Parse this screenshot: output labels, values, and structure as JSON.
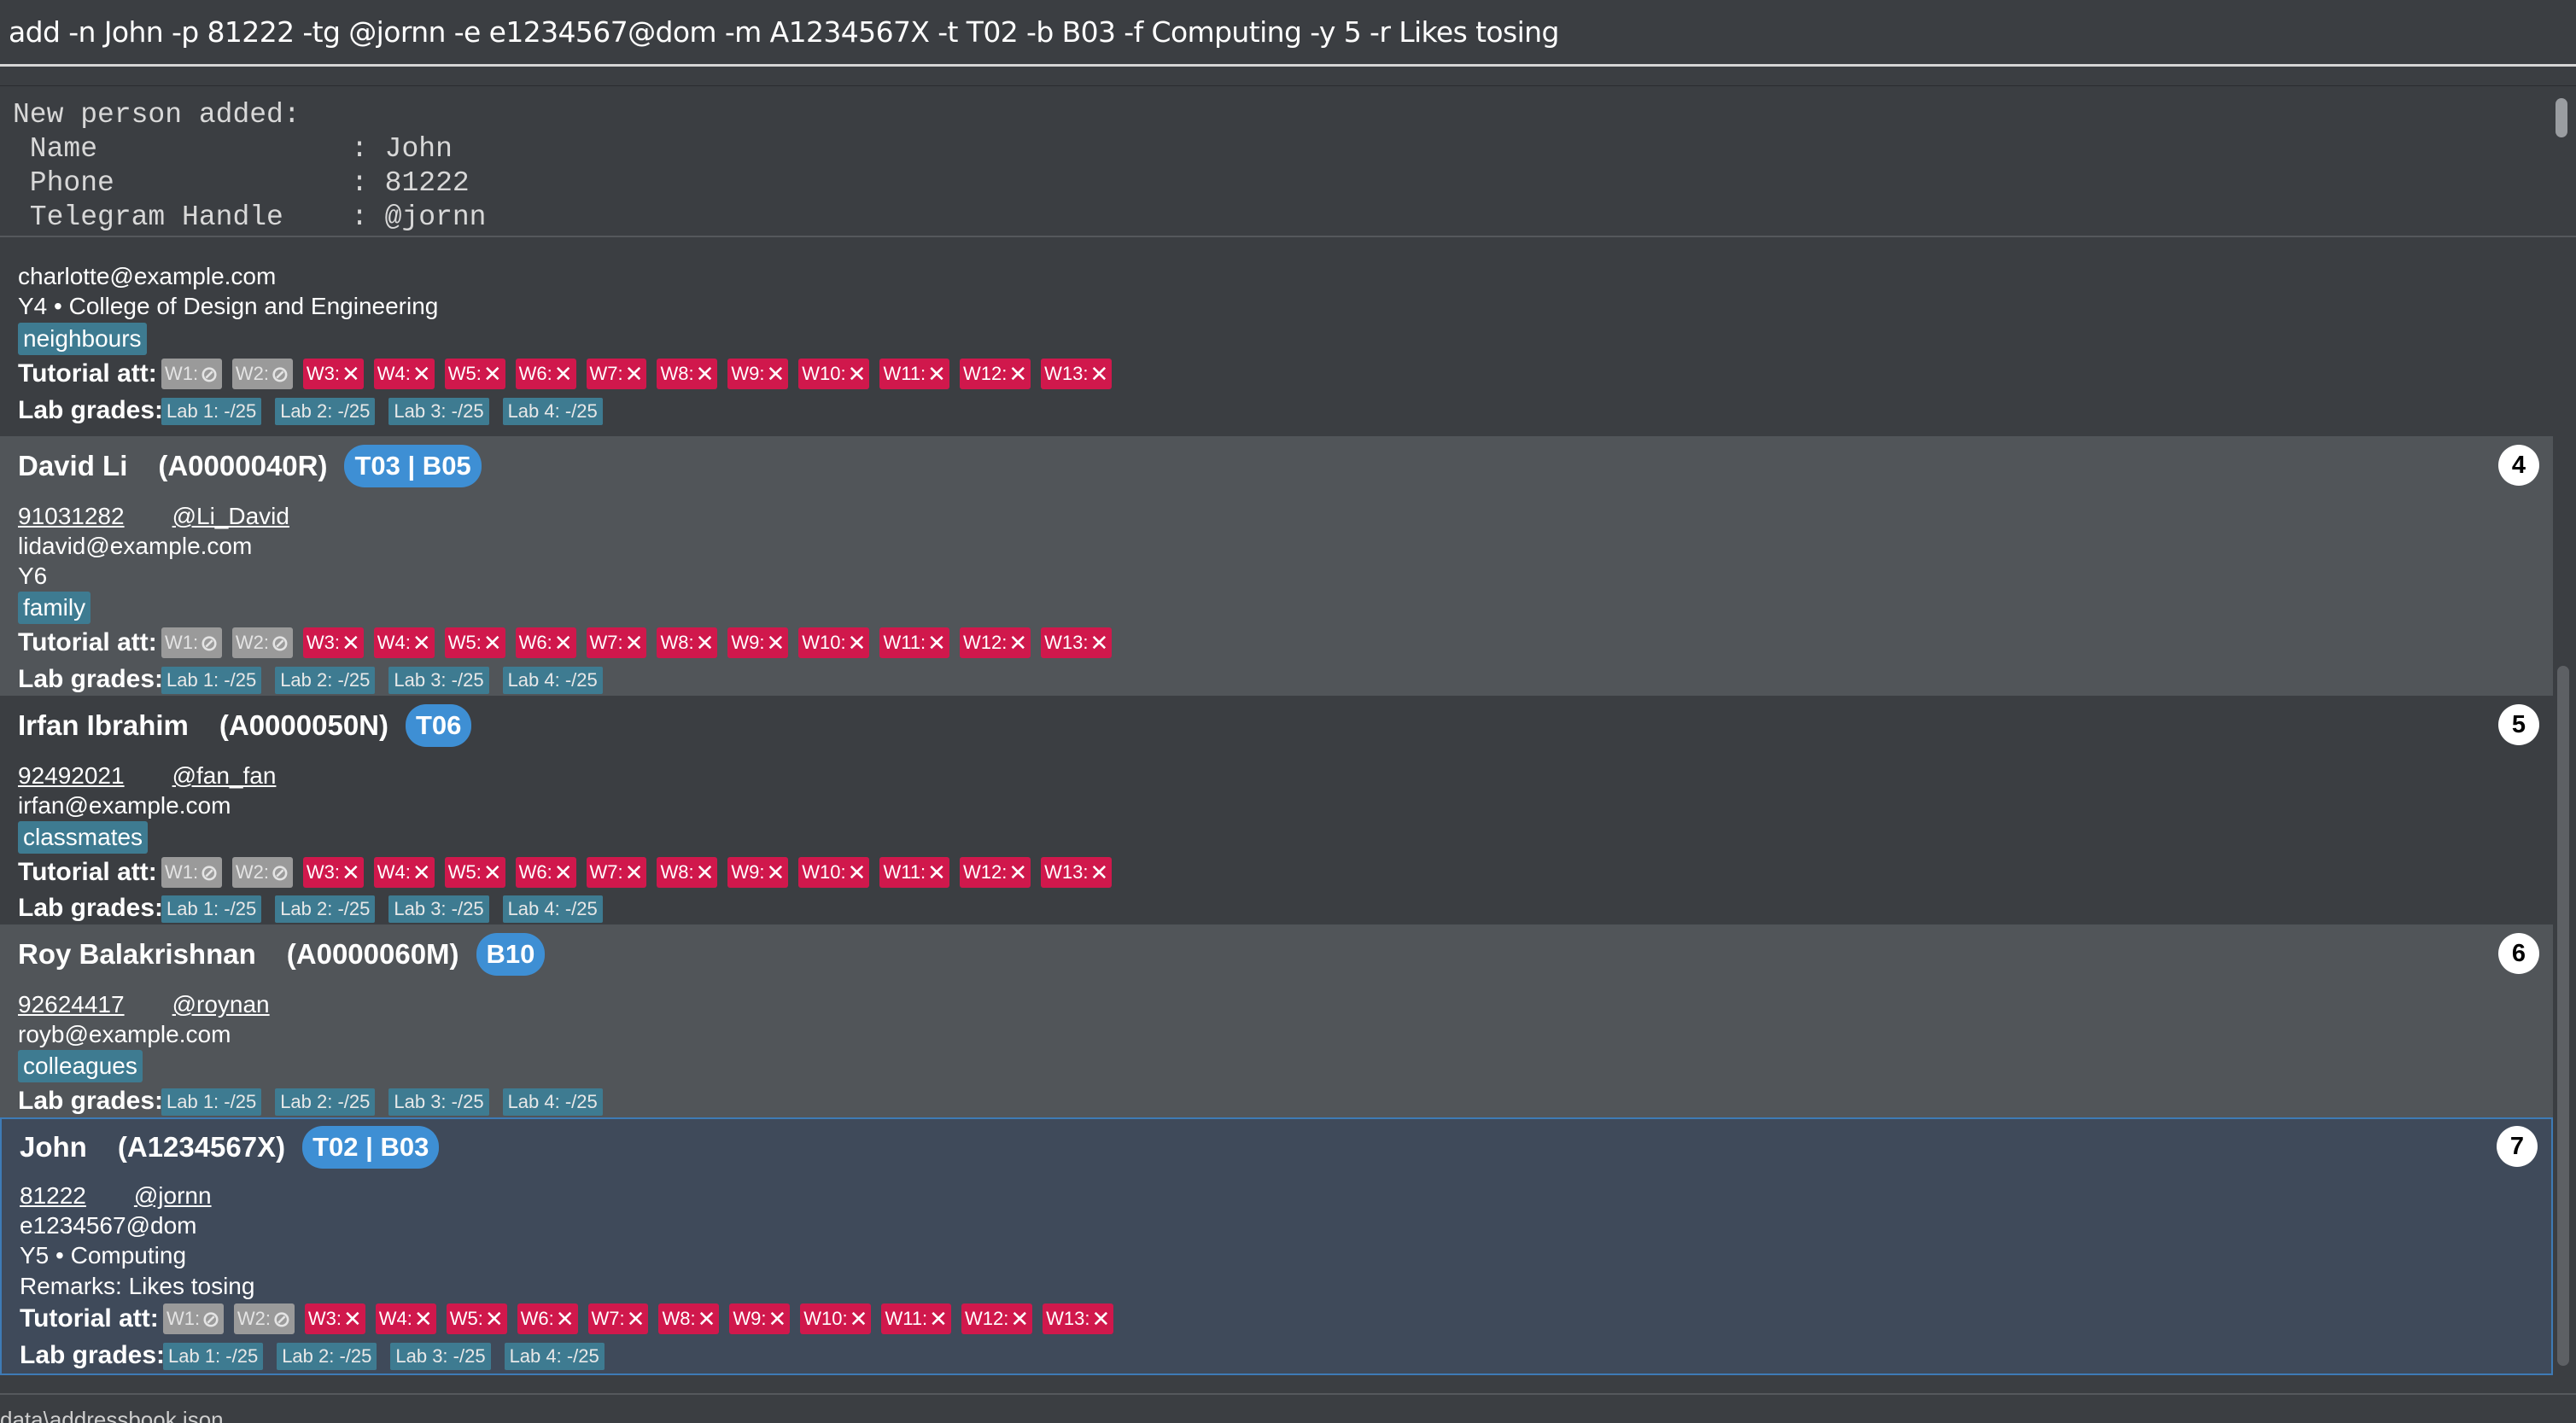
{
  "command": {
    "value": "add -n John -p 81222 -tg @jornn -e e1234567@dom -m A1234567X -t T02 -b B03 -f Computing -y 5 -r Likes tosing"
  },
  "result": {
    "text": "New person added:\n Name               : John\n Phone              : 81222\n Telegram Handle    : @jornn"
  },
  "persons": [
    {
      "email": "charlotte@example.com",
      "year_faculty": "Y4  •  College of Design and Engineering",
      "tag": "neighbours",
      "attendance_label": "Tutorial att:",
      "attendance": [
        {
          "label": "W1:",
          "mark": "⊘"
        },
        {
          "label": "W2:",
          "mark": "⊘"
        },
        {
          "label": "W3:",
          "mark": "✕"
        },
        {
          "label": "W4:",
          "mark": "✕"
        },
        {
          "label": "W5:",
          "mark": "✕"
        },
        {
          "label": "W6:",
          "mark": "✕"
        },
        {
          "label": "W7:",
          "mark": "✕"
        },
        {
          "label": "W8:",
          "mark": "✕"
        },
        {
          "label": "W9:",
          "mark": "✕"
        },
        {
          "label": "W10:",
          "mark": "✕"
        },
        {
          "label": "W11:",
          "mark": "✕"
        },
        {
          "label": "W12:",
          "mark": "✕"
        },
        {
          "label": "W13:",
          "mark": "✕"
        }
      ],
      "lab_label": "Lab grades:",
      "labs": [
        "Lab 1: -/25",
        "Lab 2: -/25",
        "Lab 3: -/25",
        "Lab 4: -/25"
      ]
    },
    {
      "name": "David Li",
      "student_id": "(A0000040R)",
      "group": "T03 | B05",
      "phone": "91031282",
      "telegram": "@Li_David",
      "email": "lidavid@example.com",
      "year_faculty": "Y6",
      "tag": "family",
      "index": "4",
      "attendance_label": "Tutorial att:",
      "lab_label": "Lab grades:",
      "labs": [
        "Lab 1: -/25",
        "Lab 2: -/25",
        "Lab 3: -/25",
        "Lab 4: -/25"
      ]
    },
    {
      "name": "Irfan Ibrahim",
      "student_id": "(A0000050N)",
      "group": "T06",
      "phone": "92492021",
      "telegram": "@fan_fan",
      "email": "irfan@example.com",
      "tag": "classmates",
      "index": "5",
      "attendance_label": "Tutorial att:",
      "lab_label": "Lab grades:",
      "labs": [
        "Lab 1: -/25",
        "Lab 2: -/25",
        "Lab 3: -/25",
        "Lab 4: -/25"
      ]
    },
    {
      "name": "Roy Balakrishnan",
      "student_id": "(A0000060M)",
      "group": "B10",
      "phone": "92624417",
      "telegram": "@roynan",
      "email": "royb@example.com",
      "tag": "colleagues",
      "index": "6",
      "lab_label": "Lab grades:",
      "labs": [
        "Lab 1: -/25",
        "Lab 2: -/25",
        "Lab 3: -/25",
        "Lab 4: -/25"
      ]
    },
    {
      "name": "John",
      "student_id": "(A1234567X)",
      "group": "T02 | B03",
      "phone": "81222",
      "telegram": "@jornn",
      "email": "e1234567@dom",
      "year_faculty": "Y5  •  Computing",
      "remarks": "Remarks: Likes tosing",
      "index": "7",
      "attendance_label": "Tutorial att:",
      "lab_label": "Lab grades:",
      "labs": [
        "Lab 1: -/25",
        "Lab 2: -/25",
        "Lab 3: -/25",
        "Lab 4: -/25"
      ]
    }
  ],
  "status": {
    "path": "data\\addressbook.json"
  },
  "colors": {
    "background": "#3b3e42",
    "card_alt": "#515559",
    "selected": "#3f4a5a",
    "absent": "#d0184c",
    "excused": "#9a9a9a",
    "tag": "#3e7b91",
    "group_badge": "#3e8fd4"
  }
}
